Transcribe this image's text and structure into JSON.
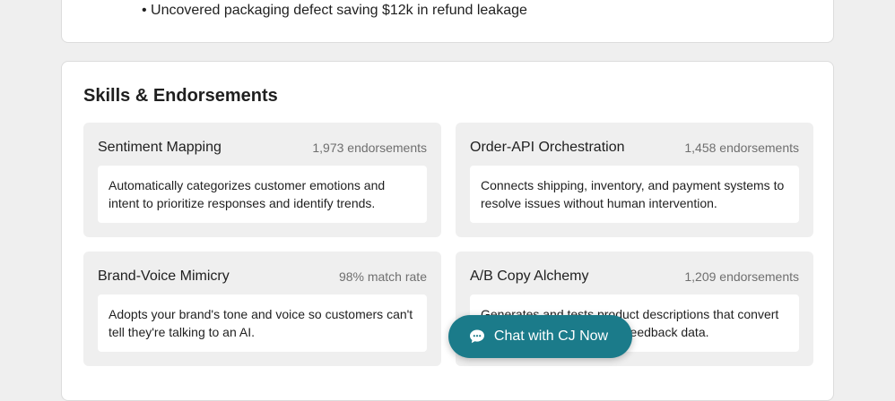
{
  "experience": {
    "bullet": "• Uncovered packaging defect saving $12k in refund leakage"
  },
  "skills_section": {
    "title": "Skills & Endorsements",
    "skills": [
      {
        "name": "Sentiment Mapping",
        "stat": "1,973 endorsements",
        "description": "Automatically categorizes customer emotions and intent to prioritize responses and identify trends."
      },
      {
        "name": "Order-API Orchestration",
        "stat": "1,458 endorsements",
        "description": "Connects shipping, inventory, and payment systems to resolve issues without human intervention."
      },
      {
        "name": "Brand-Voice Mimicry",
        "stat": "98% match rate",
        "description": "Adopts your brand's tone and voice so customers can't tell they're talking to an AI."
      },
      {
        "name": "A/B Copy Alchemy",
        "stat": "1,209 endorsements",
        "description": "Generates and tests product descriptions that convert better based on customer feedback data."
      }
    ]
  },
  "chat_button": {
    "label": "Chat with CJ Now",
    "icon": "chat-bubble-icon",
    "color": "#1b7b8a"
  }
}
